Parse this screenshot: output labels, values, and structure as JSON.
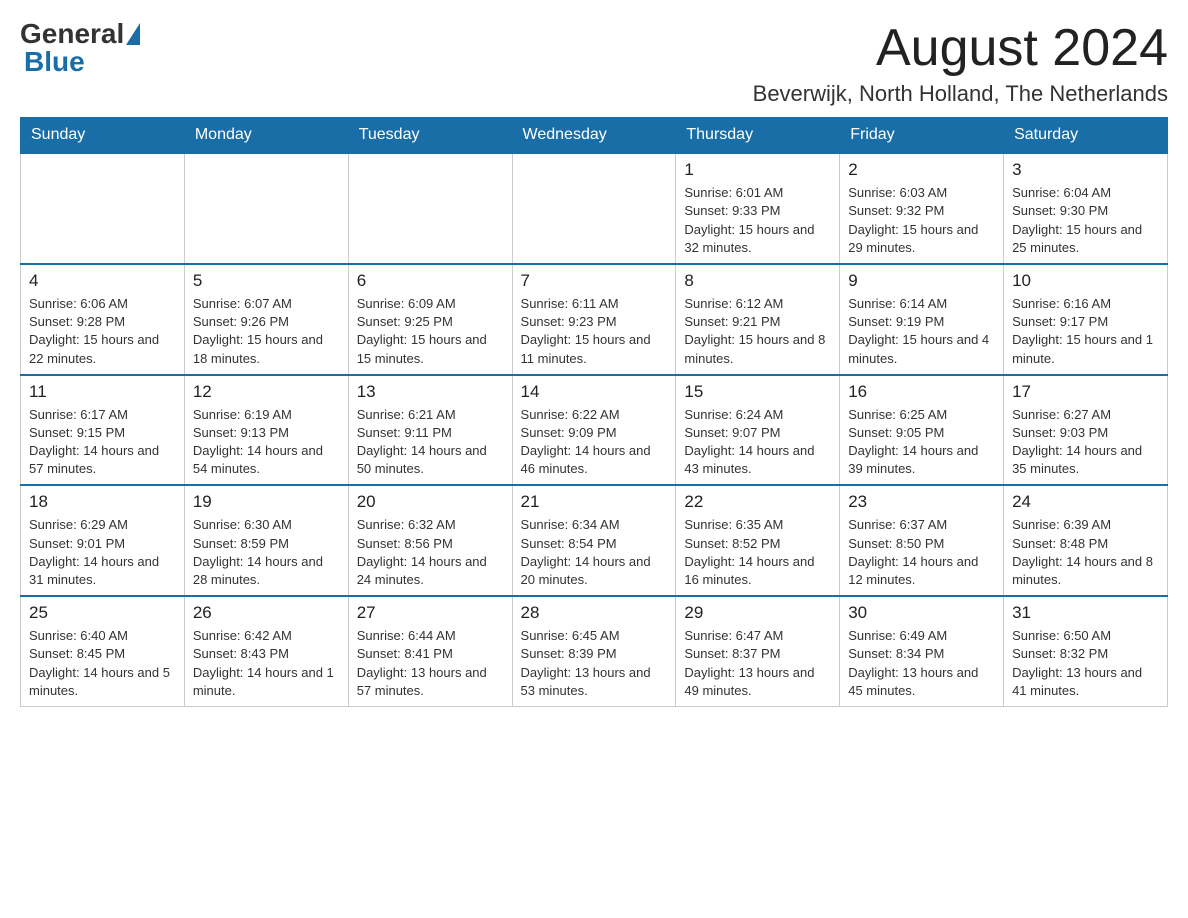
{
  "header": {
    "logo_general": "General",
    "logo_blue": "Blue",
    "month_title": "August 2024",
    "location": "Beverwijk, North Holland, The Netherlands"
  },
  "weekdays": [
    "Sunday",
    "Monday",
    "Tuesday",
    "Wednesday",
    "Thursday",
    "Friday",
    "Saturday"
  ],
  "weeks": [
    [
      {
        "day": "",
        "info": ""
      },
      {
        "day": "",
        "info": ""
      },
      {
        "day": "",
        "info": ""
      },
      {
        "day": "",
        "info": ""
      },
      {
        "day": "1",
        "info": "Sunrise: 6:01 AM\nSunset: 9:33 PM\nDaylight: 15 hours and 32 minutes."
      },
      {
        "day": "2",
        "info": "Sunrise: 6:03 AM\nSunset: 9:32 PM\nDaylight: 15 hours and 29 minutes."
      },
      {
        "day": "3",
        "info": "Sunrise: 6:04 AM\nSunset: 9:30 PM\nDaylight: 15 hours and 25 minutes."
      }
    ],
    [
      {
        "day": "4",
        "info": "Sunrise: 6:06 AM\nSunset: 9:28 PM\nDaylight: 15 hours and 22 minutes."
      },
      {
        "day": "5",
        "info": "Sunrise: 6:07 AM\nSunset: 9:26 PM\nDaylight: 15 hours and 18 minutes."
      },
      {
        "day": "6",
        "info": "Sunrise: 6:09 AM\nSunset: 9:25 PM\nDaylight: 15 hours and 15 minutes."
      },
      {
        "day": "7",
        "info": "Sunrise: 6:11 AM\nSunset: 9:23 PM\nDaylight: 15 hours and 11 minutes."
      },
      {
        "day": "8",
        "info": "Sunrise: 6:12 AM\nSunset: 9:21 PM\nDaylight: 15 hours and 8 minutes."
      },
      {
        "day": "9",
        "info": "Sunrise: 6:14 AM\nSunset: 9:19 PM\nDaylight: 15 hours and 4 minutes."
      },
      {
        "day": "10",
        "info": "Sunrise: 6:16 AM\nSunset: 9:17 PM\nDaylight: 15 hours and 1 minute."
      }
    ],
    [
      {
        "day": "11",
        "info": "Sunrise: 6:17 AM\nSunset: 9:15 PM\nDaylight: 14 hours and 57 minutes."
      },
      {
        "day": "12",
        "info": "Sunrise: 6:19 AM\nSunset: 9:13 PM\nDaylight: 14 hours and 54 minutes."
      },
      {
        "day": "13",
        "info": "Sunrise: 6:21 AM\nSunset: 9:11 PM\nDaylight: 14 hours and 50 minutes."
      },
      {
        "day": "14",
        "info": "Sunrise: 6:22 AM\nSunset: 9:09 PM\nDaylight: 14 hours and 46 minutes."
      },
      {
        "day": "15",
        "info": "Sunrise: 6:24 AM\nSunset: 9:07 PM\nDaylight: 14 hours and 43 minutes."
      },
      {
        "day": "16",
        "info": "Sunrise: 6:25 AM\nSunset: 9:05 PM\nDaylight: 14 hours and 39 minutes."
      },
      {
        "day": "17",
        "info": "Sunrise: 6:27 AM\nSunset: 9:03 PM\nDaylight: 14 hours and 35 minutes."
      }
    ],
    [
      {
        "day": "18",
        "info": "Sunrise: 6:29 AM\nSunset: 9:01 PM\nDaylight: 14 hours and 31 minutes."
      },
      {
        "day": "19",
        "info": "Sunrise: 6:30 AM\nSunset: 8:59 PM\nDaylight: 14 hours and 28 minutes."
      },
      {
        "day": "20",
        "info": "Sunrise: 6:32 AM\nSunset: 8:56 PM\nDaylight: 14 hours and 24 minutes."
      },
      {
        "day": "21",
        "info": "Sunrise: 6:34 AM\nSunset: 8:54 PM\nDaylight: 14 hours and 20 minutes."
      },
      {
        "day": "22",
        "info": "Sunrise: 6:35 AM\nSunset: 8:52 PM\nDaylight: 14 hours and 16 minutes."
      },
      {
        "day": "23",
        "info": "Sunrise: 6:37 AM\nSunset: 8:50 PM\nDaylight: 14 hours and 12 minutes."
      },
      {
        "day": "24",
        "info": "Sunrise: 6:39 AM\nSunset: 8:48 PM\nDaylight: 14 hours and 8 minutes."
      }
    ],
    [
      {
        "day": "25",
        "info": "Sunrise: 6:40 AM\nSunset: 8:45 PM\nDaylight: 14 hours and 5 minutes."
      },
      {
        "day": "26",
        "info": "Sunrise: 6:42 AM\nSunset: 8:43 PM\nDaylight: 14 hours and 1 minute."
      },
      {
        "day": "27",
        "info": "Sunrise: 6:44 AM\nSunset: 8:41 PM\nDaylight: 13 hours and 57 minutes."
      },
      {
        "day": "28",
        "info": "Sunrise: 6:45 AM\nSunset: 8:39 PM\nDaylight: 13 hours and 53 minutes."
      },
      {
        "day": "29",
        "info": "Sunrise: 6:47 AM\nSunset: 8:37 PM\nDaylight: 13 hours and 49 minutes."
      },
      {
        "day": "30",
        "info": "Sunrise: 6:49 AM\nSunset: 8:34 PM\nDaylight: 13 hours and 45 minutes."
      },
      {
        "day": "31",
        "info": "Sunrise: 6:50 AM\nSunset: 8:32 PM\nDaylight: 13 hours and 41 minutes."
      }
    ]
  ]
}
